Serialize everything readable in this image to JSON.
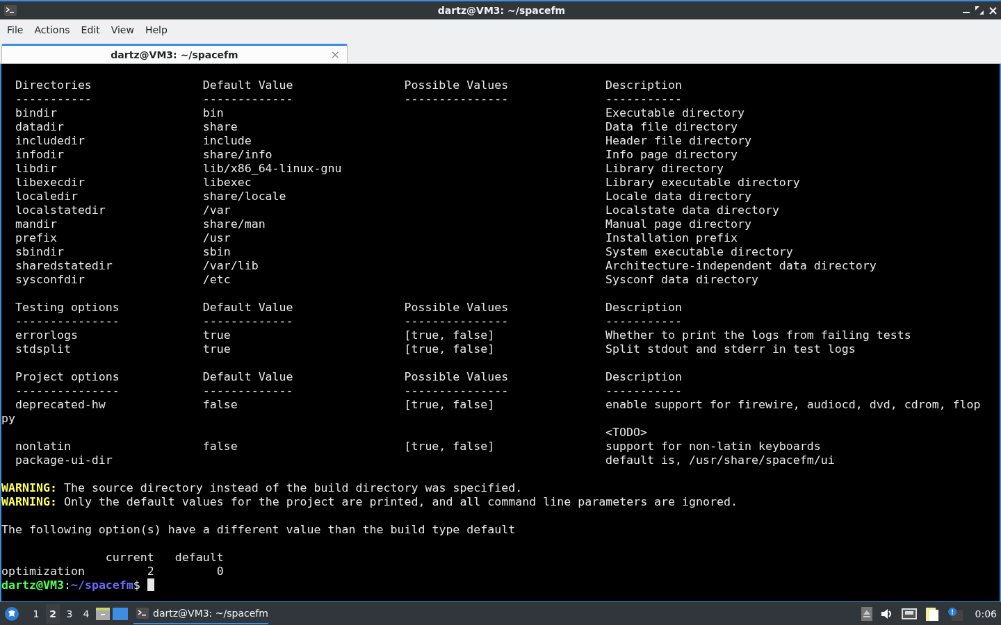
{
  "window": {
    "title": "dartz@VM3: ~/spacefm"
  },
  "menu": [
    "File",
    "Actions",
    "Edit",
    "View",
    "Help"
  ],
  "tabs": [
    {
      "title": "dartz@VM3: ~/spacefm",
      "selected": true,
      "close": "×"
    }
  ],
  "terminal": {
    "sections": [
      {
        "header": [
          "Directories",
          "Default Value",
          "Possible Values",
          "Description"
        ],
        "rule": [
          "-----------",
          "-------------",
          "---------------",
          "-----------"
        ],
        "rows": [
          {
            "cells": [
              "bindir",
              "bin",
              "",
              "Executable directory"
            ]
          },
          {
            "cells": [
              "datadir",
              "share",
              "",
              "Data file directory"
            ]
          },
          {
            "cells": [
              "includedir",
              "include",
              "",
              "Header file directory"
            ]
          },
          {
            "cells": [
              "infodir",
              "share/info",
              "",
              "Info page directory"
            ]
          },
          {
            "cells": [
              "libdir",
              "lib/x86_64-linux-gnu",
              "",
              "Library directory"
            ]
          },
          {
            "cells": [
              "libexecdir",
              "libexec",
              "",
              "Library executable directory"
            ]
          },
          {
            "cells": [
              "localedir",
              "share/locale",
              "",
              "Locale data directory"
            ]
          },
          {
            "cells": [
              "localstatedir",
              "/var",
              "",
              "Localstate data directory"
            ]
          },
          {
            "cells": [
              "mandir",
              "share/man",
              "",
              "Manual page directory"
            ]
          },
          {
            "cells": [
              "prefix",
              "/usr",
              "",
              "Installation prefix"
            ]
          },
          {
            "cells": [
              "sbindir",
              "sbin",
              "",
              "System executable directory"
            ]
          },
          {
            "cells": [
              "sharedstatedir",
              "/var/lib",
              "",
              "Architecture-independent data directory"
            ]
          },
          {
            "cells": [
              "sysconfdir",
              "/etc",
              "",
              "Sysconf data directory"
            ]
          }
        ]
      },
      {
        "header": [
          "Testing options",
          "Default Value",
          "Possible Values",
          "Description"
        ],
        "rule": [
          "---------------",
          "-------------",
          "---------------",
          "-----------"
        ],
        "rows": [
          {
            "cells": [
              "errorlogs",
              "true",
              "[true, false]",
              "Whether to print the logs from failing tests"
            ]
          },
          {
            "cells": [
              "stdsplit",
              "true",
              "[true, false]",
              "Split stdout and stderr in test logs"
            ]
          }
        ]
      },
      {
        "header": [
          "Project options",
          "Default Value",
          "Possible Values",
          "Description"
        ],
        "rule": [
          "---------------",
          "-------------",
          "---------------",
          "-----------"
        ],
        "rows": [
          {
            "cells": [
              "deprecated-hw",
              "false",
              "[true, false]",
              "enable support for firewire, audiocd, dvd, cdrom, flop"
            ],
            "wrap": "py"
          },
          {
            "cells": [
              "",
              "",
              "",
              "<TODO>"
            ]
          },
          {
            "cells": [
              "nonlatin",
              "false",
              "[true, false]",
              "support for non-latin keyboards"
            ]
          },
          {
            "cells": [
              "package-ui-dir",
              "",
              "",
              "default is, /usr/share/spacefm/ui"
            ]
          }
        ]
      }
    ],
    "warnings": [
      {
        "label": "WARNING:",
        "text": "The source directory instead of the build directory was specified."
      },
      {
        "label": "WARNING:",
        "text": "Only the default values for the project are printed, and all command line parameters are ignored."
      }
    ],
    "notice": "The following option(s) have a different value than the build type default",
    "diff": {
      "columns": [
        "current",
        "default"
      ],
      "rows": [
        {
          "name": "optimization",
          "values": [
            "2",
            "0"
          ]
        }
      ]
    },
    "prompt": {
      "user": "dartz@VM3",
      "separator": ":",
      "path": "~/spacefm",
      "symbol": "$"
    }
  },
  "taskbar": {
    "workspaces": [
      {
        "label": "1",
        "selected": false
      },
      {
        "label": "2",
        "selected": true
      },
      {
        "label": "3",
        "selected": false
      },
      {
        "label": "4",
        "selected": false
      }
    ],
    "tasks": [
      {
        "title": "dartz@VM3: ~/spacefm",
        "selected": true
      }
    ],
    "clock": "0:06"
  }
}
